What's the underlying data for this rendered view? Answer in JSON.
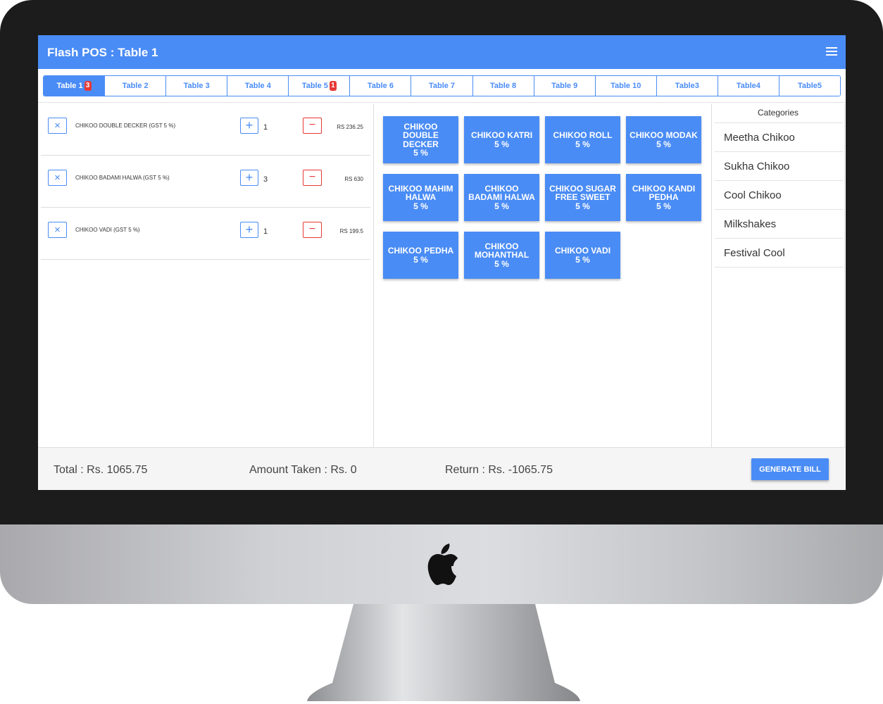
{
  "app": {
    "title": "Flash POS : Table 1"
  },
  "tabs": [
    {
      "label": "Table 1",
      "badge": "3",
      "active": true
    },
    {
      "label": "Table 2",
      "badge": ""
    },
    {
      "label": "Table 3",
      "badge": ""
    },
    {
      "label": "Table 4",
      "badge": ""
    },
    {
      "label": "Table 5",
      "badge": "1"
    },
    {
      "label": "Table 6",
      "badge": ""
    },
    {
      "label": "Table 7",
      "badge": ""
    },
    {
      "label": "Table 8",
      "badge": ""
    },
    {
      "label": "Table 9",
      "badge": ""
    },
    {
      "label": "Table 10",
      "badge": ""
    },
    {
      "label": "Table3",
      "badge": ""
    },
    {
      "label": "Table4",
      "badge": ""
    },
    {
      "label": "Table5",
      "badge": ""
    }
  ],
  "order": {
    "remove_icon": "×",
    "plus_icon": "+",
    "minus_icon": "−",
    "items": [
      {
        "name": "CHIKOO DOUBLE DECKER (GST 5 %)",
        "qty": "1",
        "price": "RS 236.25"
      },
      {
        "name": "CHIKOO BADAMI HALWA (GST 5 %)",
        "qty": "3",
        "price": "RS 630"
      },
      {
        "name": "CHIKOO VADI (GST 5 %)",
        "qty": "1",
        "price": "RS 199.5"
      }
    ]
  },
  "products": [
    {
      "name": "Chikoo Double Decker",
      "tax": "5 %"
    },
    {
      "name": "Chikoo Katri",
      "tax": "5 %"
    },
    {
      "name": "Chikoo Roll",
      "tax": "5 %"
    },
    {
      "name": "Chikoo Modak",
      "tax": "5 %"
    },
    {
      "name": "Chikoo Mahim Halwa",
      "tax": "5 %"
    },
    {
      "name": "Chikoo Badami Halwa",
      "tax": "5 %"
    },
    {
      "name": "Chikoo Sugar Free Sweet",
      "tax": "5 %"
    },
    {
      "name": "Chikoo Kandi Pedha",
      "tax": "5 %"
    },
    {
      "name": "Chikoo Pedha",
      "tax": "5 %"
    },
    {
      "name": "Chikoo Mohanthal",
      "tax": "5 %"
    },
    {
      "name": "Chikoo Vadi",
      "tax": "5 %"
    }
  ],
  "categories": {
    "title": "Categories",
    "items": [
      "Meetha Chikoo",
      "Sukha Chikoo",
      "Cool Chikoo",
      "Milkshakes",
      "Festival Cool"
    ]
  },
  "footer": {
    "total": "Total : Rs. 1065.75",
    "amount_taken": "Amount Taken : Rs. 0",
    "return": "Return : Rs. -1065.75",
    "generate_label": "GENERATE BILL"
  },
  "colors": {
    "primary": "#4a8cf5",
    "danger": "#e53935"
  }
}
